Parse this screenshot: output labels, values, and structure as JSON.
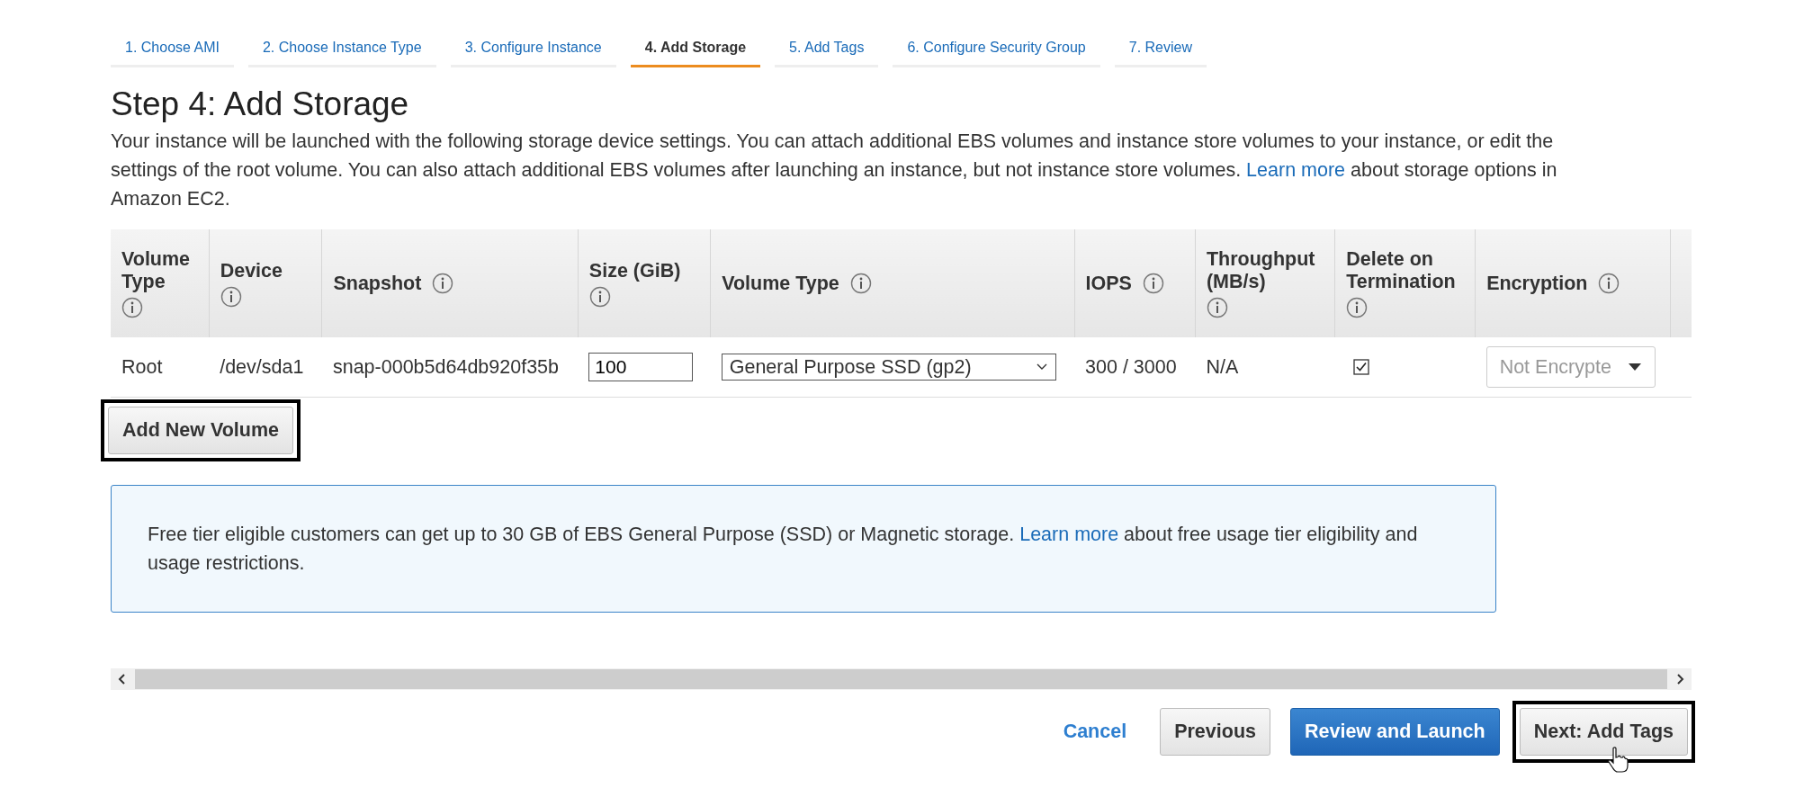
{
  "tabs": [
    {
      "label": "1. Choose AMI",
      "selected": false
    },
    {
      "label": "2. Choose Instance Type",
      "selected": false
    },
    {
      "label": "3. Configure Instance",
      "selected": false
    },
    {
      "label": "4. Add Storage",
      "selected": true
    },
    {
      "label": "5. Add Tags",
      "selected": false
    },
    {
      "label": "6. Configure Security Group",
      "selected": false
    },
    {
      "label": "7. Review",
      "selected": false
    }
  ],
  "heading": "Step 4: Add Storage",
  "description": {
    "before": "Your instance will be launched with the following storage device settings. You can attach additional EBS volumes and instance store volumes to your instance, or edit the settings of the root volume. You can also attach additional EBS volumes after launching an instance, but not instance store volumes. ",
    "link": "Learn more",
    "after": " about storage options in Amazon EC2."
  },
  "table": {
    "columns": [
      {
        "label": "Volume Type"
      },
      {
        "label": "Device"
      },
      {
        "label": "Snapshot"
      },
      {
        "label": "Size (GiB)"
      },
      {
        "label": "Volume Type"
      },
      {
        "label": "IOPS"
      },
      {
        "label": "Throughput (MB/s)"
      },
      {
        "label": "Delete on Termination"
      },
      {
        "label": "Encryption"
      }
    ],
    "rows": [
      [
        {
          "kind": "text",
          "value": "Root"
        },
        {
          "kind": "text",
          "value": "/dev/sda1"
        },
        {
          "kind": "text",
          "value": "snap-000b5d64db920f35b"
        },
        {
          "kind": "input",
          "value": "100"
        },
        {
          "kind": "select",
          "value": "General Purpose SSD (gp2)"
        },
        {
          "kind": "text",
          "value": "300 / 3000"
        },
        {
          "kind": "text",
          "value": "N/A"
        },
        {
          "kind": "checkbox",
          "checked": true
        },
        {
          "kind": "dropdown",
          "value": "Not Encrypte",
          "disabled": true
        }
      ]
    ]
  },
  "add_volume_button": {
    "label": "Add New Volume",
    "highlighted": true
  },
  "info_box": {
    "before": "Free tier eligible customers can get up to 30 GB of EBS General Purpose (SSD) or Magnetic storage. ",
    "link": "Learn more",
    "after": " about free usage tier eligibility and usage restrictions."
  },
  "footer_buttons": [
    {
      "label": "Cancel",
      "kind": "link",
      "highlighted": false,
      "pointer": false
    },
    {
      "label": "Previous",
      "kind": "default",
      "highlighted": false,
      "pointer": false
    },
    {
      "label": "Review and Launch",
      "kind": "primary",
      "highlighted": false,
      "pointer": false
    },
    {
      "label": "Next: Add Tags",
      "kind": "default",
      "highlighted": true,
      "pointer": true
    }
  ]
}
